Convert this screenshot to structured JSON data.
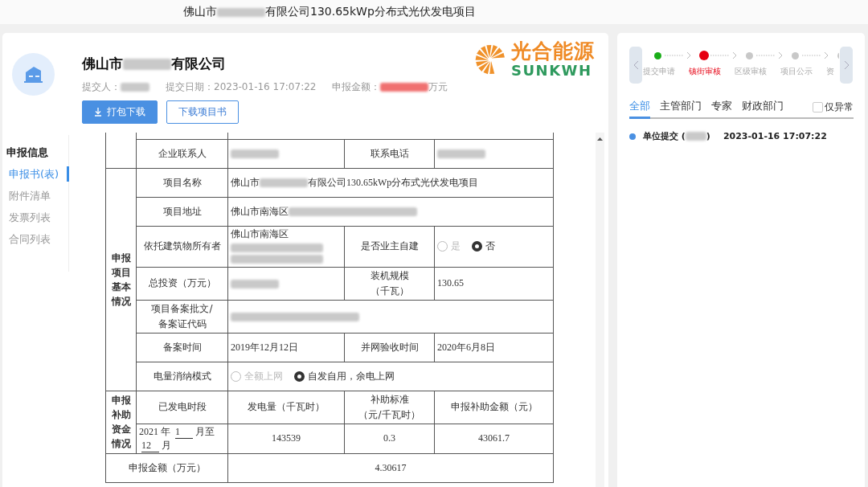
{
  "page_title": {
    "parts": [
      {
        "kind": "text",
        "text": "佛山市"
      },
      {
        "kind": "redacted"
      },
      {
        "kind": "text",
        "text": "有限公司130.65kWp分布式光伏发电项目"
      }
    ]
  },
  "company": {
    "name": [
      {
        "kind": "text",
        "text": "佛山市"
      },
      {
        "kind": "redacted"
      },
      {
        "kind": "text",
        "text": "有限公司"
      }
    ],
    "meta": [
      {
        "parts": [
          {
            "kind": "text",
            "text": "提交人："
          },
          {
            "kind": "redacted"
          }
        ]
      },
      {
        "parts": [
          {
            "kind": "text",
            "text": "提交日期：2023-01-16 17:07:22"
          }
        ]
      },
      {
        "parts": [
          {
            "kind": "text",
            "text": "申报金额："
          },
          {
            "kind": "redacted",
            "color": "#f07070"
          },
          {
            "kind": "text",
            "text": "万元"
          }
        ]
      }
    ]
  },
  "buttons": [
    {
      "label": "打包下载",
      "kind": "primary"
    },
    {
      "label": "下载项目书",
      "kind": "outline"
    }
  ],
  "logo": {
    "cn": "光合能源",
    "en": "SUNKWH"
  },
  "side_nav": {
    "title": "申报信息",
    "items": [
      {
        "label": "申报书(表)",
        "selected": true
      },
      {
        "label": "附件清单",
        "selected": false
      },
      {
        "label": "发票列表",
        "selected": false
      },
      {
        "label": "合同列表",
        "selected": false
      }
    ]
  },
  "table": {
    "rows": [
      {
        "cells": [
          {
            "kind": "blank",
            "rowspan": 2
          },
          {
            "kind": "blank"
          },
          {
            "kind": "blank",
            "colspan": 3
          }
        ]
      },
      {
        "cells": [
          {
            "kind": "label",
            "text": "企业联系人"
          },
          {
            "kind": "value",
            "parts": [
              {
                "kind": "redacted"
              }
            ]
          },
          {
            "kind": "label",
            "text": "联系电话"
          },
          {
            "kind": "value",
            "parts": [
              {
                "kind": "redacted"
              }
            ]
          }
        ]
      },
      {
        "cells": [
          {
            "kind": "section",
            "text": "申报项目基本情况",
            "rowspan": 7
          },
          {
            "kind": "label",
            "text": "项目名称"
          },
          {
            "kind": "value",
            "colspan": 3,
            "parts": [
              {
                "kind": "text",
                "text": "佛山市"
              },
              {
                "kind": "redacted"
              },
              {
                "kind": "text",
                "text": "有限公司130.65kWp分布式光伏发电项目"
              }
            ]
          }
        ]
      },
      {
        "cells": [
          {
            "kind": "label",
            "text": "项目地址"
          },
          {
            "kind": "value",
            "colspan": 3,
            "parts": [
              {
                "kind": "text",
                "text": "佛山市南海区"
              },
              {
                "kind": "redacted"
              }
            ]
          }
        ]
      },
      {
        "cells": [
          {
            "kind": "label",
            "text": "依托建筑物所有者"
          },
          {
            "kind": "value",
            "parts": [
              {
                "kind": "text",
                "text": "佛山市南海区"
              },
              {
                "kind": "redacted_block"
              }
            ]
          },
          {
            "kind": "label",
            "text": "是否业主自建"
          },
          {
            "kind": "radio",
            "options": [
              {
                "label": "是",
                "selected": false
              },
              {
                "label": "否",
                "selected": true
              }
            ]
          }
        ]
      },
      {
        "cells": [
          {
            "kind": "label",
            "text": "总投资（万元）"
          },
          {
            "kind": "value",
            "parts": [
              {
                "kind": "redacted"
              }
            ]
          },
          {
            "kind": "label",
            "lines": [
              "装机规模",
              "（千瓦）"
            ]
          },
          {
            "kind": "value",
            "parts": [
              {
                "kind": "text",
                "text": "130.65"
              }
            ]
          }
        ]
      },
      {
        "cells": [
          {
            "kind": "label",
            "lines": [
              "项目备案批文/",
              "备案证代码"
            ]
          },
          {
            "kind": "value",
            "colspan": 3,
            "parts": [
              {
                "kind": "redacted"
              }
            ]
          }
        ]
      },
      {
        "cells": [
          {
            "kind": "label",
            "text": "备案时间"
          },
          {
            "kind": "value",
            "parts": [
              {
                "kind": "text",
                "text": "2019年12月12日"
              }
            ]
          },
          {
            "kind": "label",
            "text": "并网验收时间"
          },
          {
            "kind": "value",
            "parts": [
              {
                "kind": "text",
                "text": "2020年6月8日"
              }
            ]
          }
        ]
      },
      {
        "cells": [
          {
            "kind": "label",
            "text": "电量消纳模式"
          },
          {
            "kind": "radio",
            "colspan": 3,
            "options": [
              {
                "label": "全额上网",
                "selected": false
              },
              {
                "label": "自发自用，余电上网",
                "selected": true
              }
            ]
          }
        ]
      },
      {
        "cells": [
          {
            "kind": "section",
            "text": "申报补助资金情况",
            "rowspan": 2
          },
          {
            "kind": "label",
            "text": "已发电时段"
          },
          {
            "kind": "label",
            "text": "发电量（千瓦时）"
          },
          {
            "kind": "label",
            "lines": [
              "补助标准",
              "（元/千瓦时）"
            ]
          },
          {
            "kind": "label",
            "text": "申报补助金额（元）"
          }
        ]
      },
      {
        "cells": [
          {
            "kind": "value",
            "parts": [
              {
                "kind": "text",
                "text": "2021 年 "
              },
              {
                "kind": "field",
                "text": "1"
              },
              {
                "kind": "text",
                "text": "月至"
              },
              {
                "kind": "field",
                "text": "12"
              },
              {
                "kind": "text",
                "text": "月"
              }
            ]
          },
          {
            "kind": "number",
            "text": "143539"
          },
          {
            "kind": "number",
            "text": "0.3"
          },
          {
            "kind": "number",
            "text": "43061.7"
          }
        ]
      },
      {
        "cells": [
          {
            "kind": "label",
            "text": "申报金额（万元）",
            "colspan": 2
          },
          {
            "kind": "number",
            "text": "4.30617",
            "colspan": 3
          }
        ]
      }
    ]
  },
  "steps": [
    {
      "label": "提交申请",
      "done": true,
      "current": false
    },
    {
      "label": "镇街审核",
      "done": false,
      "current": true
    },
    {
      "label": "区级审核",
      "done": false,
      "current": false
    },
    {
      "label": "项目公示",
      "done": false,
      "current": false
    },
    {
      "label": "资",
      "done": false,
      "current": false
    }
  ],
  "tabs": [
    {
      "label": "全部",
      "selected": true
    },
    {
      "label": "主管部门",
      "selected": false
    },
    {
      "label": "专家",
      "selected": false
    },
    {
      "label": "财政部门",
      "selected": false
    }
  ],
  "filter": {
    "label": "仅异常",
    "checked": false
  },
  "timeline": [
    {
      "parts": [
        {
          "kind": "text",
          "text": "单位提交 ("
        },
        {
          "kind": "redacted"
        },
        {
          "kind": "text",
          "text": ")"
        }
      ],
      "time": "2023-01-16 17:07:22",
      "color": "#4a90e2"
    }
  ]
}
